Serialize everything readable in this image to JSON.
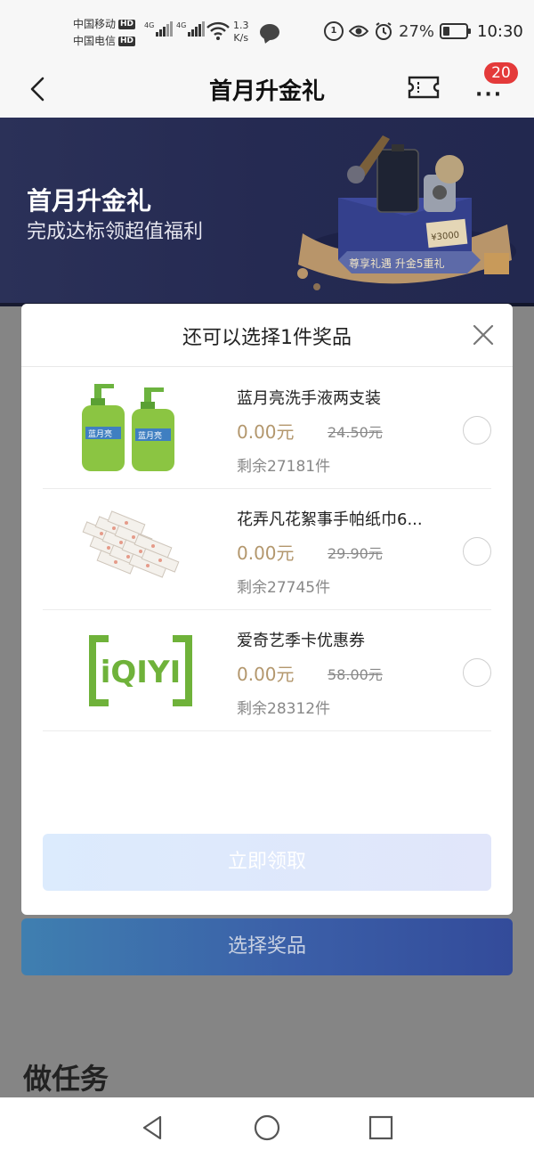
{
  "status_bar": {
    "carrier1": "中国移动",
    "carrier2": "中国电信",
    "hd": "HD",
    "net1": "4G",
    "net2": "4G",
    "speed_value": "1.3",
    "speed_unit": "K/s",
    "battery": "27%",
    "time": "10:30"
  },
  "nav": {
    "title": "首月升金礼",
    "badge": "20"
  },
  "banner": {
    "title": "首月升金礼",
    "subtitle": "完成达标领超值福利",
    "coupon_text": "¥3000",
    "ribbon_text": "尊享礼遇 升金5重礼"
  },
  "modal": {
    "title": "还可以选择1件奖品",
    "prizes": [
      {
        "name": "蓝月亮洗手液两支装",
        "price": "0.00元",
        "original": "24.50元",
        "stock": "剩余27181件"
      },
      {
        "name": "花弄凡花絮事手帕纸巾6...",
        "price": "0.00元",
        "original": "29.90元",
        "stock": "剩余27745件"
      },
      {
        "name": "爱奇艺季卡优惠券",
        "price": "0.00元",
        "original": "58.00元",
        "stock": "剩余28312件"
      }
    ],
    "claim_label": "立即领取",
    "logo_text": "iQIYI",
    "bottle_text": "蓝月亮"
  },
  "page": {
    "select_label": "选择奖品",
    "task_title": "做任务"
  },
  "colors": {
    "price": "#b3976d",
    "badge": "#e43a3a",
    "banner_bg": "#252a52",
    "iqiyi_green": "#6fb23a"
  }
}
